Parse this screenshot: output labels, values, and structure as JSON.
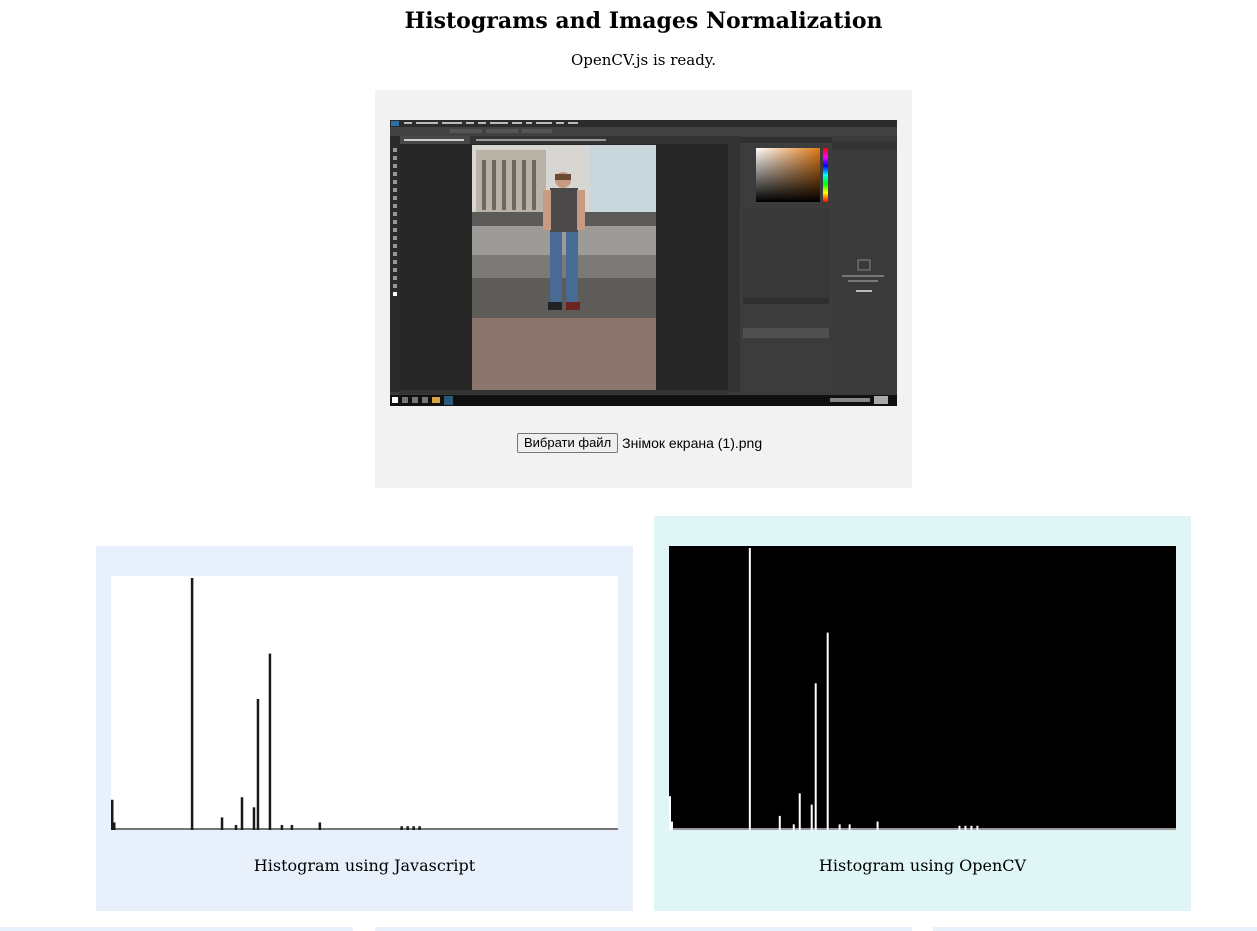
{
  "page": {
    "title": "Histograms and Images Normalization",
    "status": "OpenCV.js is ready."
  },
  "file_input": {
    "button_label": "Вибрати файл",
    "file_name": "Знімок екрана (1).png"
  },
  "histograms": [
    {
      "caption": "Histogram using Javascript",
      "background": "#ffffff",
      "bar_color": "#1a1a1a"
    },
    {
      "caption": "Histogram using OpenCV",
      "background": "#000000",
      "bar_color": "#ffffff"
    }
  ],
  "histogram_bins": [
    {
      "bin": 0,
      "value": 0.12
    },
    {
      "bin": 1,
      "value": 0.03
    },
    {
      "bin": 40,
      "value": 1.0
    },
    {
      "bin": 55,
      "value": 0.05
    },
    {
      "bin": 62,
      "value": 0.02
    },
    {
      "bin": 65,
      "value": 0.13
    },
    {
      "bin": 71,
      "value": 0.09
    },
    {
      "bin": 73,
      "value": 0.52
    },
    {
      "bin": 79,
      "value": 0.7
    },
    {
      "bin": 85,
      "value": 0.02
    },
    {
      "bin": 90,
      "value": 0.02
    },
    {
      "bin": 104,
      "value": 0.03
    },
    {
      "bin": 145,
      "value": 0.015
    },
    {
      "bin": 148,
      "value": 0.015
    },
    {
      "bin": 151,
      "value": 0.015
    },
    {
      "bin": 154,
      "value": 0.015
    }
  ],
  "colors": {
    "input_card": "#f2f2f2",
    "js_card": "#e7f0fb",
    "cv_card": "#dff5f6"
  }
}
